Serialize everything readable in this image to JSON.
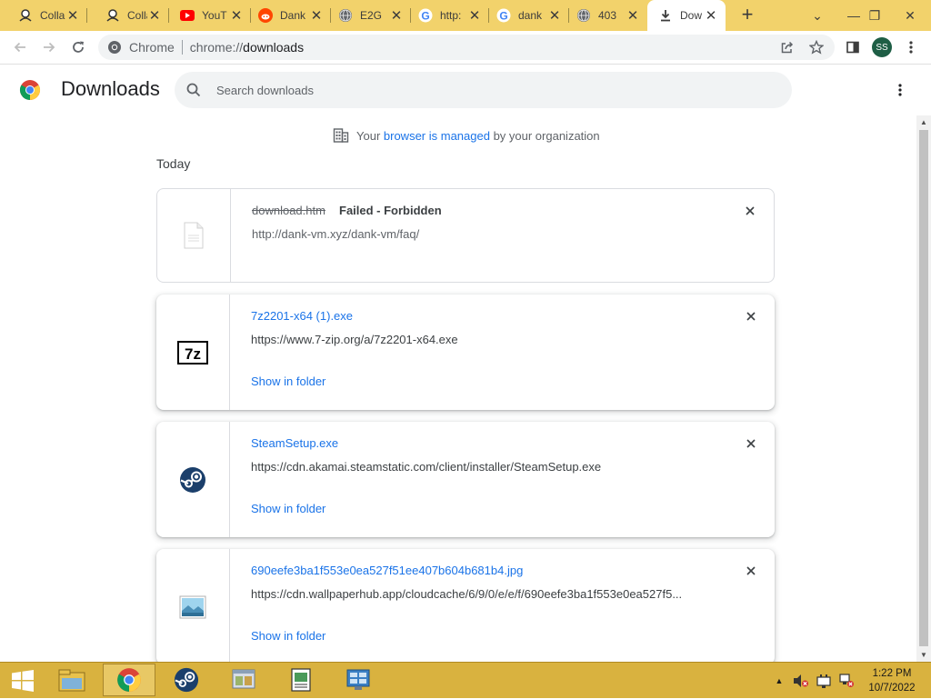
{
  "tabs": [
    {
      "title": "Colla",
      "favicon": "collab-icon"
    },
    {
      "title": "Colla",
      "favicon": "collab-icon"
    },
    {
      "title": "YouT",
      "favicon": "youtube-icon"
    },
    {
      "title": "Dank",
      "favicon": "reddit-icon"
    },
    {
      "title": "E2G",
      "favicon": "globe-icon"
    },
    {
      "title": "http:",
      "favicon": "google-icon"
    },
    {
      "title": "dank",
      "favicon": "google-icon"
    },
    {
      "title": "403",
      "favicon": "globe-icon"
    },
    {
      "title": "Dow",
      "favicon": "download-icon",
      "active": true
    }
  ],
  "toolbar": {
    "site_chip": "Chrome",
    "url_scheme": "chrome://",
    "url_path": "downloads",
    "profile_initials": "SS"
  },
  "downloads_page": {
    "title": "Downloads",
    "search_placeholder": "Search downloads",
    "managed_prefix": "Your ",
    "managed_link": "browser is managed",
    "managed_suffix": " by your organization",
    "date_header": "Today"
  },
  "downloads": [
    {
      "name": "download.htm",
      "status": "Failed - Forbidden",
      "url": "http://dank-vm.xyz/dank-vm/faq/",
      "icon": "file-icon",
      "failed": true
    },
    {
      "name": "7z2201-x64 (1).exe",
      "url": "https://www.7-zip.org/a/7z2201-x64.exe",
      "action": "Show in folder",
      "icon": "7zip-icon"
    },
    {
      "name": "SteamSetup.exe",
      "url": "https://cdn.akamai.steamstatic.com/client/installer/SteamSetup.exe",
      "action": "Show in folder",
      "icon": "steam-icon"
    },
    {
      "name": "690eefe3ba1f553e0ea527f51ee407b604b681b4.jpg",
      "url": "https://cdn.wallpaperhub.app/cloudcache/6/9/0/e/e/f/690eefe3ba1f553e0ea527f5...",
      "action": "Show in folder",
      "icon": "image-icon"
    }
  ],
  "taskbar": {
    "time": "1:22 PM",
    "date": "10/7/2022"
  },
  "colors": {
    "tabstrip": "#f2d26b",
    "taskbar": "#d9b23f",
    "link": "#1a73e8"
  }
}
